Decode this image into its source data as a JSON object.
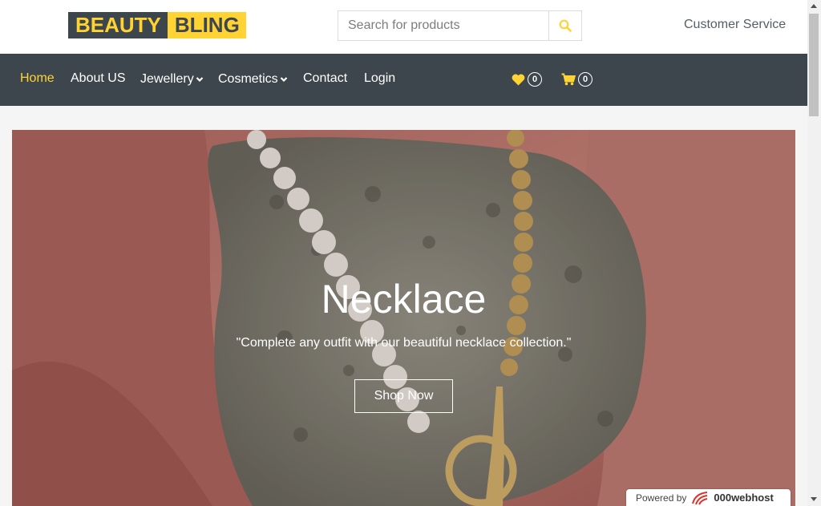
{
  "header": {
    "logo_part1": "BEAUTY",
    "logo_part2": "BLING",
    "search_placeholder": "Search for products",
    "customer_service": "Customer Service"
  },
  "nav": {
    "items": [
      {
        "label": "Home",
        "active": true
      },
      {
        "label": "About US"
      },
      {
        "label": "Jewellery",
        "dropdown": true
      },
      {
        "label": "Cosmetics",
        "dropdown": true
      },
      {
        "label": "Contact"
      },
      {
        "label": "Login"
      }
    ],
    "wishlist_count": "0",
    "cart_count": "0"
  },
  "hero": {
    "title": "Necklace",
    "subtitle": "\"Complete any outfit with our beautiful necklace collection.\"",
    "button": "Shop Now"
  },
  "footer_badge": {
    "prefix": "Powered by",
    "brand": "000webhost"
  },
  "colors": {
    "accent": "#ffd333",
    "dark": "#3d464d"
  },
  "icons": {
    "search": "search-icon",
    "wishlist": "heart-icon",
    "cart": "cart-icon",
    "dropdown": "chevron-down-icon"
  }
}
